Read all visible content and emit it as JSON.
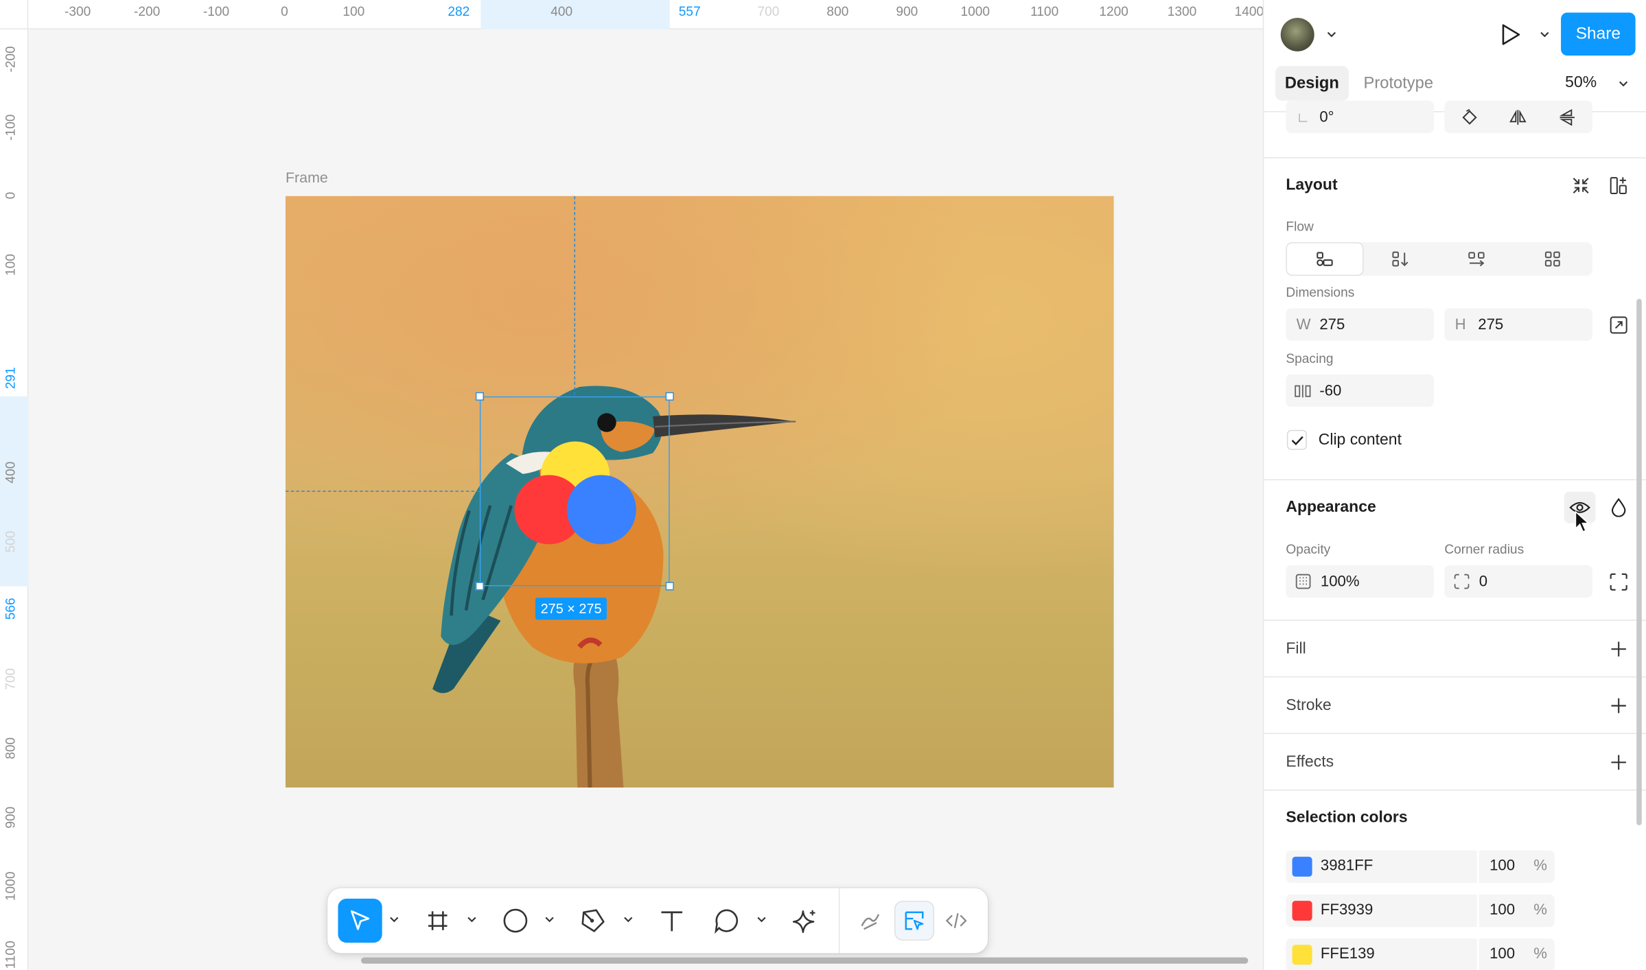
{
  "ruler_top": {
    "labels": [
      "-300",
      "-200",
      "-100",
      "0",
      "100",
      "282",
      "400",
      "557",
      "700",
      "800",
      "900",
      "1000",
      "1100",
      "1200",
      "1300",
      "1400"
    ],
    "highlighted": [
      "282",
      "557"
    ],
    "faint": [
      "700"
    ]
  },
  "ruler_left": {
    "labels": [
      "-200",
      "-100",
      "0",
      "100",
      "291",
      "400",
      "500",
      "566",
      "700",
      "800",
      "900",
      "1000",
      "1100"
    ],
    "highlighted": [
      "291",
      "566"
    ],
    "faint": [
      "500",
      "700"
    ]
  },
  "canvas": {
    "frame_label": "Frame",
    "selection_size": "275 × 275"
  },
  "toolbar": {
    "tools": [
      {
        "name": "move-tool",
        "icon": "cursor-arrow-icon",
        "active": true
      },
      {
        "name": "frame-tool",
        "icon": "hash-frame-icon"
      },
      {
        "name": "ellipse-tool",
        "icon": "circle-icon"
      },
      {
        "name": "pen-tool",
        "icon": "pen-nib-icon"
      },
      {
        "name": "text-tool",
        "icon": "text-t-icon"
      },
      {
        "name": "comment-tool",
        "icon": "speech-bubble-icon"
      },
      {
        "name": "ai-tool",
        "icon": "sparkle-icon"
      },
      {
        "name": "draw-mode",
        "icon": "pencil-squiggle-icon"
      },
      {
        "name": "design-mode",
        "icon": "design-mode-icon"
      },
      {
        "name": "dev-mode",
        "icon": "code-brackets-icon"
      }
    ]
  },
  "panel": {
    "share_label": "Share",
    "tabs": {
      "design": "Design",
      "prototype": "Prototype"
    },
    "zoom": "50%",
    "rotation": "0°",
    "layout": {
      "title": "Layout",
      "flow_label": "Flow",
      "dimensions_label": "Dimensions",
      "width_prefix": "W",
      "width": "275",
      "height_prefix": "H",
      "height": "275",
      "spacing_label": "Spacing",
      "spacing": "-60",
      "clip_label": "Clip content",
      "clip_checked": true
    },
    "appearance": {
      "title": "Appearance",
      "opacity_label": "Opacity",
      "opacity": "100%",
      "radius_label": "Corner radius",
      "radius": "0"
    },
    "fill": "Fill",
    "stroke": "Stroke",
    "effects": "Effects",
    "selection_colors": {
      "title": "Selection colors",
      "items": [
        {
          "hex": "3981FF",
          "color": "#3981FF",
          "opacity": "100",
          "unit": "%"
        },
        {
          "hex": "FF3939",
          "color": "#FF3939",
          "opacity": "100",
          "unit": "%"
        },
        {
          "hex": "FFE139",
          "color": "#FFE139",
          "opacity": "100",
          "unit": "%"
        }
      ]
    }
  },
  "colors": {
    "accent": "#0d99ff",
    "circle_yellow": "#FFE139",
    "circle_red": "#FF3939",
    "circle_blue": "#3981FF"
  }
}
